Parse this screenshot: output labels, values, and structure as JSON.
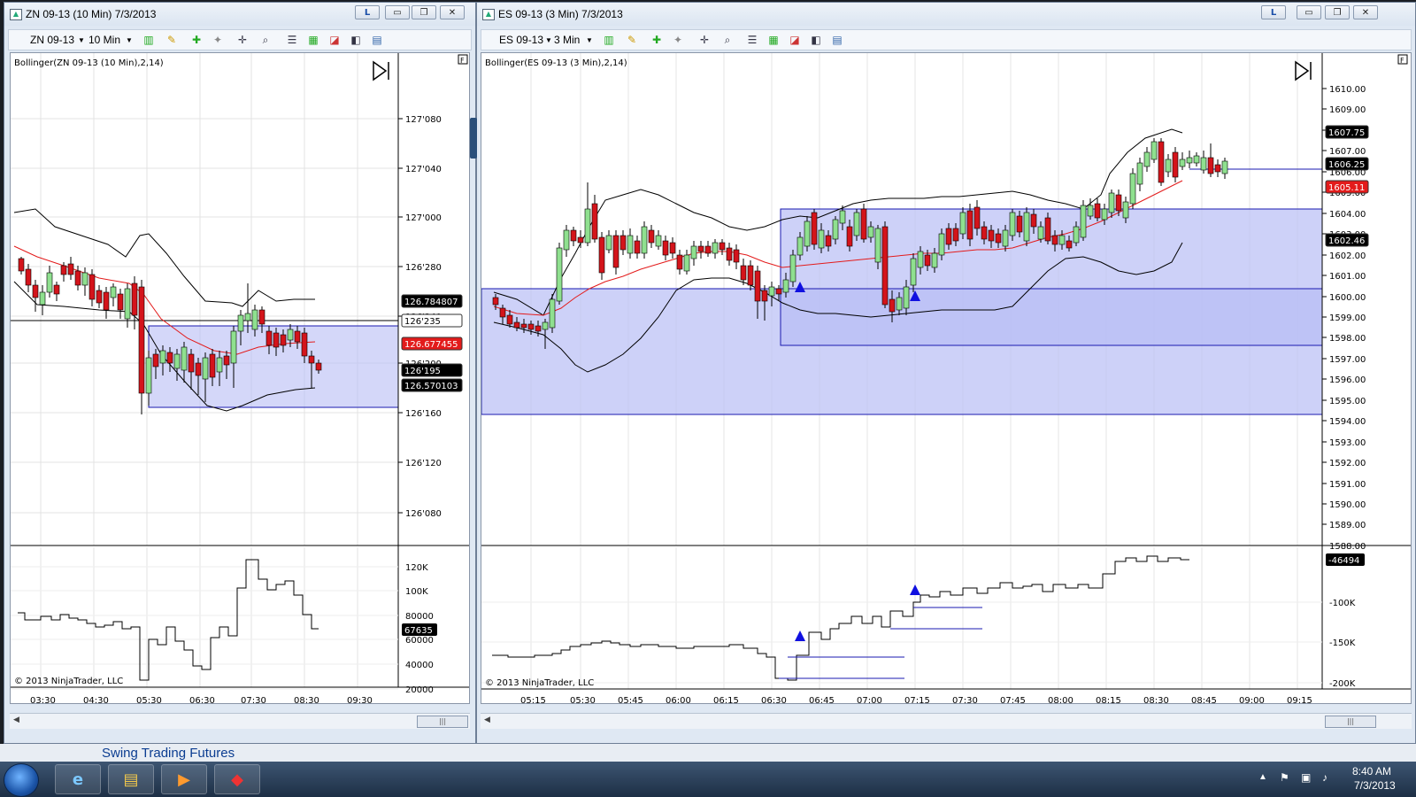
{
  "desktop": {
    "background_link": "Swing Trading Futures"
  },
  "left_window": {
    "title": "ZN 09-13 (10 Min)  7/3/2013",
    "title_buttons": [
      "L",
      "▭",
      "❐",
      "✕"
    ],
    "toolbar": {
      "instrument": "ZN 09-13",
      "interval": "10 Min"
    },
    "indicator_label": "Bollinger(ZN 09-13 (10 Min),2,14)",
    "copyright": "© 2013 NinjaTrader, LLC",
    "price_axis": [
      "127'080",
      "127'040",
      "127'000",
      "126'280",
      "126'240",
      "126'200",
      "126'160",
      "126'120",
      "126'080"
    ],
    "price_badges": [
      {
        "text": "126.784807",
        "color": "#000000"
      },
      {
        "text": "126'235",
        "color": "#ffffff"
      },
      {
        "text": "126.677455",
        "color": "#e31b1b"
      },
      {
        "text": "126'195",
        "color": "#000000"
      },
      {
        "text": "126.570103",
        "color": "#000000"
      }
    ],
    "volume_axis": [
      "120K",
      "100K",
      "80000",
      "60000",
      "40000",
      "20000"
    ],
    "volume_badge": "67635",
    "time_axis": [
      "03:30",
      "04:30",
      "05:30",
      "06:30",
      "07:30",
      "08:30",
      "09:30"
    ]
  },
  "right_window": {
    "title": "ES 09-13 (3 Min)  7/3/2013",
    "title_buttons": [
      "L",
      "▭",
      "❐",
      "✕"
    ],
    "toolbar": {
      "instrument": "ES 09-13",
      "interval": "3 Min"
    },
    "indicator_label": "Bollinger(ES 09-13 (3 Min),2,14)",
    "copyright": "© 2013 NinjaTrader, LLC",
    "price_axis": [
      "1610.00",
      "1609.00",
      "1608.00",
      "1607.00",
      "1606.00",
      "1605.00",
      "1604.00",
      "1603.00",
      "1602.00",
      "1601.00",
      "1600.00",
      "1599.00",
      "1598.00",
      "1597.00",
      "1596.00",
      "1595.00",
      "1594.00",
      "1593.00",
      "1592.00",
      "1591.00",
      "1590.00",
      "1589.00",
      "1588.00"
    ],
    "price_badges": [
      {
        "text": "1607.75",
        "color": "#000000"
      },
      {
        "text": "1606.25",
        "color": "#000000"
      },
      {
        "text": "1605.11",
        "color": "#e31b1b"
      },
      {
        "text": "1602.46",
        "color": "#000000"
      }
    ],
    "volume_axis": [
      "-100K",
      "-150K",
      "-200K"
    ],
    "volume_badge": "-46494",
    "time_axis": [
      "05:15",
      "05:30",
      "05:45",
      "06:00",
      "06:15",
      "06:30",
      "06:45",
      "07:00",
      "07:15",
      "07:30",
      "07:45",
      "08:00",
      "08:15",
      "08:30",
      "08:45",
      "09:00",
      "09:15"
    ]
  },
  "taskbar": {
    "clock_time": "8:40 AM",
    "clock_date": "7/3/2013",
    "apps": [
      "internet-explorer-icon",
      "folder-icon",
      "media-player-icon",
      "ninjatrader-icon"
    ]
  },
  "colors": {
    "up_candle": "#8fe08f",
    "down_candle": "#d4141b",
    "band": "#000000",
    "middle": "#e31b1b",
    "zone_fill": "#b8bdf5",
    "zone_line": "#1a1ab0",
    "signal": "#1010e0"
  }
}
